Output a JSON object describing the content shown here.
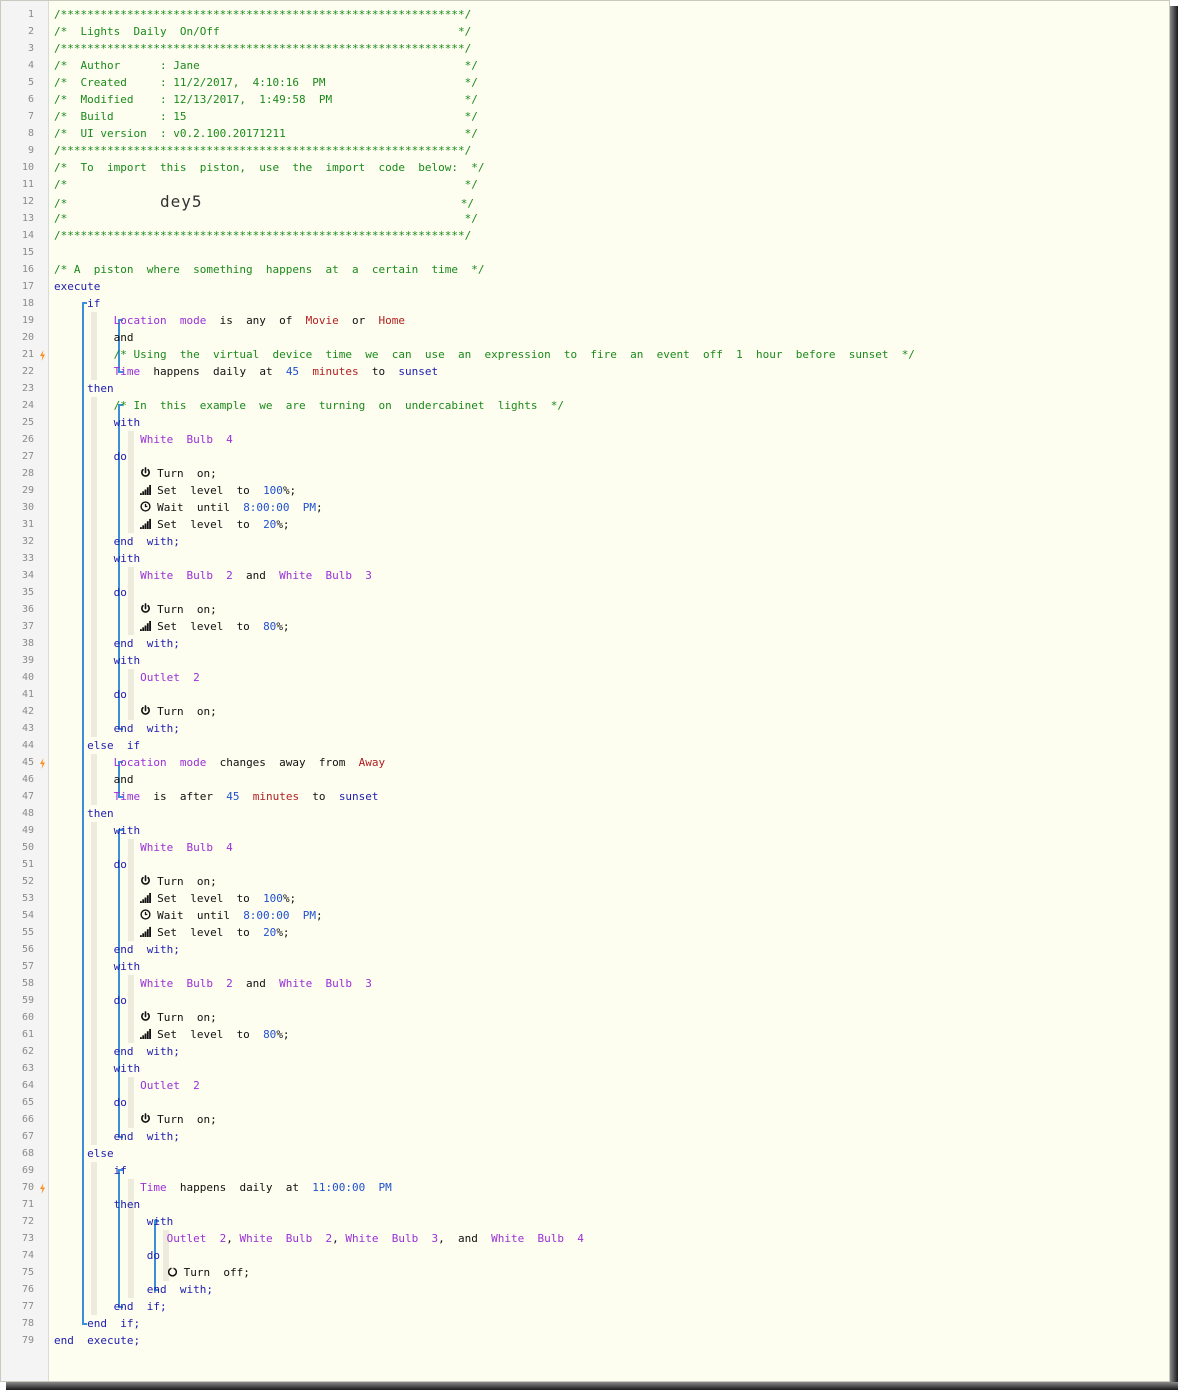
{
  "lines": [
    [
      {
        "t": "/*************************************************************/",
        "c": "cm"
      }
    ],
    [
      {
        "t": "/*  Lights  Daily  On/Off                                    */",
        "c": "cm"
      }
    ],
    [
      {
        "t": "/*************************************************************/",
        "c": "cm"
      }
    ],
    [
      {
        "t": "/*  Author      : Jane                                        */",
        "c": "cm"
      }
    ],
    [
      {
        "t": "/*  Created     : 11/2/2017,  4:10:16  PM                     */",
        "c": "cm"
      }
    ],
    [
      {
        "t": "/*  Modified    : 12/13/2017,  1:49:58  PM                    */",
        "c": "cm"
      }
    ],
    [
      {
        "t": "/*  Build       : 15                                          */",
        "c": "cm"
      }
    ],
    [
      {
        "t": "/*  UI version  : v0.2.100.20171211                           */",
        "c": "cm"
      }
    ],
    [
      {
        "t": "/*************************************************************/",
        "c": "cm"
      }
    ],
    [
      {
        "t": "/*  To  import  this  piston,  use  the  import  code  below:  */",
        "c": "cm"
      }
    ],
    [
      {
        "t": "/*                                                            */",
        "c": "cm"
      }
    ],
    [
      {
        "t": "/*              ",
        "c": "cm"
      },
      {
        "t": "dey5",
        "c": "pin"
      },
      {
        "t": "                                       */",
        "c": "cm"
      }
    ],
    [
      {
        "t": "/*                                                            */",
        "c": "cm"
      }
    ],
    [
      {
        "t": "/*************************************************************/",
        "c": "cm"
      }
    ],
    [],
    [
      {
        "t": "/* A  piston  where  something  happens  at  a  certain  time  */",
        "c": "cm"
      }
    ],
    [
      {
        "t": "execute",
        "c": "kw"
      }
    ],
    [
      {
        "t": "     if",
        "c": "kw"
      }
    ],
    [
      {
        "t": "         ",
        "c": "tx"
      },
      {
        "t": "Location  mode",
        "c": "sv"
      },
      {
        "t": "  is  any  of  ",
        "c": "tx"
      },
      {
        "t": "Movie",
        "c": "lit"
      },
      {
        "t": "  or  ",
        "c": "tx"
      },
      {
        "t": "Home",
        "c": "lit"
      }
    ],
    [
      {
        "t": "         and",
        "c": "tx"
      }
    ],
    [
      {
        "t": "         /* Using  the  virtual  device  time  we  can  use  an  expression  to  fire  an  event  off  1  hour  before  sunset  */",
        "c": "cm"
      }
    ],
    [
      {
        "t": "         ",
        "c": "tx"
      },
      {
        "t": "Time",
        "c": "sv"
      },
      {
        "t": "  happens  daily  at  ",
        "c": "tx"
      },
      {
        "t": "45",
        "c": "num"
      },
      {
        "t": "  ",
        "c": "tx"
      },
      {
        "t": "minutes",
        "c": "lit"
      },
      {
        "t": "  to  ",
        "c": "tx"
      },
      {
        "t": "sunset",
        "c": "kw"
      }
    ],
    [
      {
        "t": "     then",
        "c": "kw"
      }
    ],
    [
      {
        "t": "         /* In  this  example  we  are  turning  on  undercabinet  lights  */",
        "c": "cm"
      }
    ],
    [
      {
        "t": "         with",
        "c": "kw"
      }
    ],
    [
      {
        "t": "             ",
        "c": "tx"
      },
      {
        "t": "White  Bulb  4",
        "c": "dv"
      }
    ],
    [
      {
        "t": "         do",
        "c": "kw"
      }
    ],
    [
      {
        "t": "             ",
        "c": "tx"
      },
      {
        "i": "power"
      },
      {
        "t": "Turn  on;",
        "c": "tx"
      }
    ],
    [
      {
        "t": "             ",
        "c": "tx"
      },
      {
        "i": "level"
      },
      {
        "t": "Set  level  to  ",
        "c": "tx"
      },
      {
        "t": "100",
        "c": "num"
      },
      {
        "t": "%;",
        "c": "tx"
      }
    ],
    [
      {
        "t": "             ",
        "c": "tx"
      },
      {
        "i": "clock"
      },
      {
        "t": "Wait  until  ",
        "c": "tx"
      },
      {
        "t": "8:00:00  PM",
        "c": "num"
      },
      {
        "t": ";",
        "c": "tx"
      }
    ],
    [
      {
        "t": "             ",
        "c": "tx"
      },
      {
        "i": "level"
      },
      {
        "t": "Set  level  to  ",
        "c": "tx"
      },
      {
        "t": "20",
        "c": "num"
      },
      {
        "t": "%;",
        "c": "tx"
      }
    ],
    [
      {
        "t": "         end  with;",
        "c": "kw"
      }
    ],
    [
      {
        "t": "         with",
        "c": "kw"
      }
    ],
    [
      {
        "t": "             ",
        "c": "tx"
      },
      {
        "t": "White  Bulb  2",
        "c": "dv"
      },
      {
        "t": "  and  ",
        "c": "tx"
      },
      {
        "t": "White  Bulb  3",
        "c": "dv"
      }
    ],
    [
      {
        "t": "         do",
        "c": "kw"
      }
    ],
    [
      {
        "t": "             ",
        "c": "tx"
      },
      {
        "i": "power"
      },
      {
        "t": "Turn  on;",
        "c": "tx"
      }
    ],
    [
      {
        "t": "             ",
        "c": "tx"
      },
      {
        "i": "level"
      },
      {
        "t": "Set  level  to  ",
        "c": "tx"
      },
      {
        "t": "80",
        "c": "num"
      },
      {
        "t": "%;",
        "c": "tx"
      }
    ],
    [
      {
        "t": "         end  with;",
        "c": "kw"
      }
    ],
    [
      {
        "t": "         with",
        "c": "kw"
      }
    ],
    [
      {
        "t": "             ",
        "c": "tx"
      },
      {
        "t": "Outlet  2",
        "c": "dv"
      }
    ],
    [
      {
        "t": "         do",
        "c": "kw"
      }
    ],
    [
      {
        "t": "             ",
        "c": "tx"
      },
      {
        "i": "power"
      },
      {
        "t": "Turn  on;",
        "c": "tx"
      }
    ],
    [
      {
        "t": "         end  with;",
        "c": "kw"
      }
    ],
    [
      {
        "t": "     else  if",
        "c": "kw"
      }
    ],
    [
      {
        "t": "         ",
        "c": "tx"
      },
      {
        "t": "Location  mode",
        "c": "sv"
      },
      {
        "t": "  changes  away  from  ",
        "c": "tx"
      },
      {
        "t": "Away",
        "c": "lit"
      }
    ],
    [
      {
        "t": "         and",
        "c": "tx"
      }
    ],
    [
      {
        "t": "         ",
        "c": "tx"
      },
      {
        "t": "Time",
        "c": "sv"
      },
      {
        "t": "  is  after  ",
        "c": "tx"
      },
      {
        "t": "45",
        "c": "num"
      },
      {
        "t": "  ",
        "c": "tx"
      },
      {
        "t": "minutes",
        "c": "lit"
      },
      {
        "t": "  to  ",
        "c": "tx"
      },
      {
        "t": "sunset",
        "c": "kw"
      }
    ],
    [
      {
        "t": "     then",
        "c": "kw"
      }
    ],
    [
      {
        "t": "         with",
        "c": "kw"
      }
    ],
    [
      {
        "t": "             ",
        "c": "tx"
      },
      {
        "t": "White  Bulb  4",
        "c": "dv"
      }
    ],
    [
      {
        "t": "         do",
        "c": "kw"
      }
    ],
    [
      {
        "t": "             ",
        "c": "tx"
      },
      {
        "i": "power"
      },
      {
        "t": "Turn  on;",
        "c": "tx"
      }
    ],
    [
      {
        "t": "             ",
        "c": "tx"
      },
      {
        "i": "level"
      },
      {
        "t": "Set  level  to  ",
        "c": "tx"
      },
      {
        "t": "100",
        "c": "num"
      },
      {
        "t": "%;",
        "c": "tx"
      }
    ],
    [
      {
        "t": "             ",
        "c": "tx"
      },
      {
        "i": "clock"
      },
      {
        "t": "Wait  until  ",
        "c": "tx"
      },
      {
        "t": "8:00:00  PM",
        "c": "num"
      },
      {
        "t": ";",
        "c": "tx"
      }
    ],
    [
      {
        "t": "             ",
        "c": "tx"
      },
      {
        "i": "level"
      },
      {
        "t": "Set  level  to  ",
        "c": "tx"
      },
      {
        "t": "20",
        "c": "num"
      },
      {
        "t": "%;",
        "c": "tx"
      }
    ],
    [
      {
        "t": "         end  with;",
        "c": "kw"
      }
    ],
    [
      {
        "t": "         with",
        "c": "kw"
      }
    ],
    [
      {
        "t": "             ",
        "c": "tx"
      },
      {
        "t": "White  Bulb  2",
        "c": "dv"
      },
      {
        "t": "  and  ",
        "c": "tx"
      },
      {
        "t": "White  Bulb  3",
        "c": "dv"
      }
    ],
    [
      {
        "t": "         do",
        "c": "kw"
      }
    ],
    [
      {
        "t": "             ",
        "c": "tx"
      },
      {
        "i": "power"
      },
      {
        "t": "Turn  on;",
        "c": "tx"
      }
    ],
    [
      {
        "t": "             ",
        "c": "tx"
      },
      {
        "i": "level"
      },
      {
        "t": "Set  level  to  ",
        "c": "tx"
      },
      {
        "t": "80",
        "c": "num"
      },
      {
        "t": "%;",
        "c": "tx"
      }
    ],
    [
      {
        "t": "         end  with;",
        "c": "kw"
      }
    ],
    [
      {
        "t": "         with",
        "c": "kw"
      }
    ],
    [
      {
        "t": "             ",
        "c": "tx"
      },
      {
        "t": "Outlet  2",
        "c": "dv"
      }
    ],
    [
      {
        "t": "         do",
        "c": "kw"
      }
    ],
    [
      {
        "t": "             ",
        "c": "tx"
      },
      {
        "i": "power"
      },
      {
        "t": "Turn  on;",
        "c": "tx"
      }
    ],
    [
      {
        "t": "         end  with;",
        "c": "kw"
      }
    ],
    [
      {
        "t": "     else",
        "c": "kw"
      }
    ],
    [
      {
        "t": "         if",
        "c": "kw"
      }
    ],
    [
      {
        "t": "             ",
        "c": "tx"
      },
      {
        "t": "Time",
        "c": "sv"
      },
      {
        "t": "  happens  daily  at  ",
        "c": "tx"
      },
      {
        "t": "11:00:00  PM",
        "c": "num"
      }
    ],
    [
      {
        "t": "         then",
        "c": "kw"
      }
    ],
    [
      {
        "t": "              with",
        "c": "kw"
      }
    ],
    [
      {
        "t": "                 ",
        "c": "tx"
      },
      {
        "t": "Outlet  2",
        "c": "dv"
      },
      {
        "t": ", ",
        "c": "tx"
      },
      {
        "t": "White  Bulb  2",
        "c": "dv"
      },
      {
        "t": ", ",
        "c": "tx"
      },
      {
        "t": "White  Bulb  3",
        "c": "dv"
      },
      {
        "t": ",  and  ",
        "c": "tx"
      },
      {
        "t": "White  Bulb  4",
        "c": "dv"
      }
    ],
    [
      {
        "t": "              do",
        "c": "kw"
      }
    ],
    [
      {
        "t": "                 ",
        "c": "tx"
      },
      {
        "i": "off"
      },
      {
        "t": "Turn  off;",
        "c": "tx"
      }
    ],
    [
      {
        "t": "              end  with;",
        "c": "kw"
      }
    ],
    [
      {
        "t": "         end  if;",
        "c": "kw"
      }
    ],
    [
      {
        "t": "     end  if;",
        "c": "kw"
      }
    ],
    [
      {
        "t": "end  execute;",
        "c": "kw"
      }
    ]
  ],
  "bolt_lines": [
    21,
    45,
    70
  ],
  "colors": {
    "comment": "#1b8a1b",
    "keyword": "#2020b0",
    "device": "#9b30d8",
    "literal": "#b02020",
    "number": "#2050d0",
    "bracket": "#3a8fd8",
    "bolt": "#ff8c1a"
  }
}
